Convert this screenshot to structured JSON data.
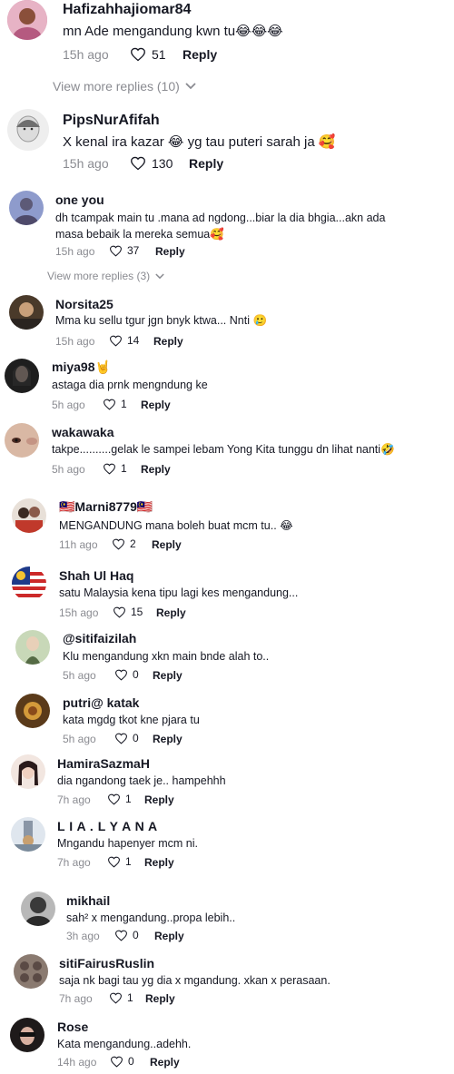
{
  "comments": [
    {
      "username": "Hafizahhajiomar84",
      "text": "mn Ade mengandung kwn tu😂😂😂",
      "time": "15h ago",
      "likes": "51",
      "reply": "Reply",
      "avatar_color": "#c97a9a"
    },
    {
      "username": "PipsNurAfifah",
      "text": "X kenal ira kazar 😂 yg tau puteri sarah ja 🥰",
      "time": "15h ago",
      "likes": "130",
      "reply": "Reply",
      "avatar_color": "#d9d9d9"
    },
    {
      "username": "one you",
      "text": "dh tcampak main tu .mana ad ngdong...biar la dia bhgia...akn ada masa bebaik la mereka semua🥰",
      "time": "15h ago",
      "likes": "37",
      "reply": "Reply",
      "avatar_color": "#7a86b8"
    },
    {
      "username": "Norsita25",
      "text": "Mma ku sellu tgur jgn bnyk ktwa... Nnti 🥲",
      "time": "15h ago",
      "likes": "14",
      "reply": "Reply",
      "avatar_color": "#8a6a4a"
    },
    {
      "username": "miya98🤘",
      "text": "astaga dia prnk mengndung ke",
      "time": "5h ago",
      "likes": "1",
      "reply": "Reply",
      "avatar_color": "#2b2b2b"
    },
    {
      "username": "wakawaka",
      "text": "takpe..........gelak le sampei lebam Yong Kita tunggu dn lihat nanti🤣",
      "time": "5h ago",
      "likes": "1",
      "reply": "Reply",
      "avatar_color": "#c9a08a"
    },
    {
      "username": "🇲🇾Marni8779🇲🇾",
      "text": "MENGANDUNG mana boleh buat mcm tu.. 😂",
      "time": "11h ago",
      "likes": "2",
      "reply": "Reply",
      "avatar_color": "#b8453a"
    },
    {
      "username": "Shah Ul Haq",
      "text": "satu Malaysia kena tipu lagi kes mengandung...",
      "time": "15h ago",
      "likes": "15",
      "reply": "Reply",
      "avatar_color": "#3a6fc4"
    },
    {
      "username": "@sitifaizilah",
      "text": "Klu mengandung xkn main bnde alah to..",
      "time": "5h ago",
      "likes": "0",
      "reply": "Reply",
      "avatar_color": "#6f8f5a"
    },
    {
      "username": "putri@ katak",
      "text": "kata mgdg tkot kne pjara tu",
      "time": "5h ago",
      "likes": "0",
      "reply": "Reply",
      "avatar_color": "#a8743a"
    },
    {
      "username": "HamiraSazmaH",
      "text": "dia ngandong taek je.. hampehhh",
      "time": "7h ago",
      "likes": "1",
      "reply": "Reply",
      "avatar_color": "#d8b8a8"
    },
    {
      "username": "L I A . L Y A N A",
      "text": "Mngandu hapenyer mcm ni.",
      "time": "7h ago",
      "likes": "1",
      "reply": "Reply",
      "avatar_color": "#9aa8b8"
    },
    {
      "username": "mikhail",
      "text": "sah² x mengandung..propa lebih..",
      "time": "3h ago",
      "likes": "0",
      "reply": "Reply",
      "avatar_color": "#4a4a4a"
    },
    {
      "username": "sitiFairusRuslin",
      "text": "saja nk bagi tau yg dia x mgandung. xkan x perasaan.",
      "time": "7h ago",
      "likes": "1",
      "reply": "Reply",
      "avatar_color": "#6a5a55"
    },
    {
      "username": "Rose",
      "text": "Kata mengandung..adehh.",
      "time": "14h ago",
      "likes": "0",
      "reply": "Reply",
      "avatar_color": "#2e2a2a"
    }
  ],
  "view_more": [
    {
      "label": "View more replies (10)"
    },
    {
      "label": "View more replies (3)"
    }
  ]
}
